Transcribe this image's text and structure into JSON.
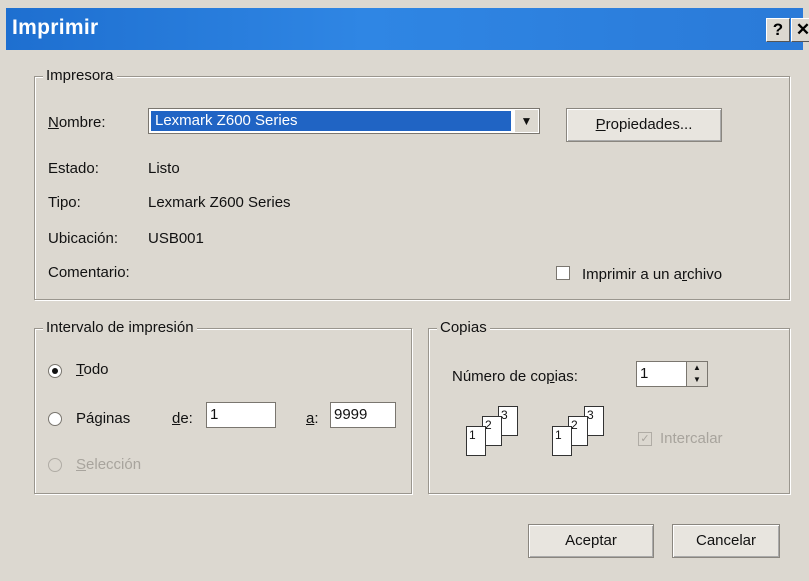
{
  "window": {
    "title": "Imprimir",
    "help_label": "?",
    "close_label": "✕"
  },
  "printer": {
    "group_label": "Impresora",
    "name_label": "Nombre:",
    "name_value": "Lexmark Z600 Series",
    "properties_label": "Propiedades...",
    "status_label": "Estado:",
    "status_value": "Listo",
    "type_label": "Tipo:",
    "type_value": "Lexmark Z600 Series",
    "location_label": "Ubicación:",
    "location_value": "USB001",
    "comment_label": "Comentario:",
    "print_to_file_label": "Imprimir a un archivo"
  },
  "range": {
    "group_label": "Intervalo de impresión",
    "all_label": "Todo",
    "pages_label": "Páginas",
    "from_label": "de:",
    "from_value": "1",
    "to_label": "a:",
    "to_value": "9999",
    "selection_label": "Selección"
  },
  "copies": {
    "group_label": "Copias",
    "count_label": "Número de copias:",
    "count_value": "1",
    "collate_label": "Intercalar",
    "collate_checked": true,
    "page_numbers": [
      "1",
      "2",
      "3"
    ]
  },
  "footer": {
    "ok_label": "Aceptar",
    "cancel_label": "Cancelar"
  }
}
